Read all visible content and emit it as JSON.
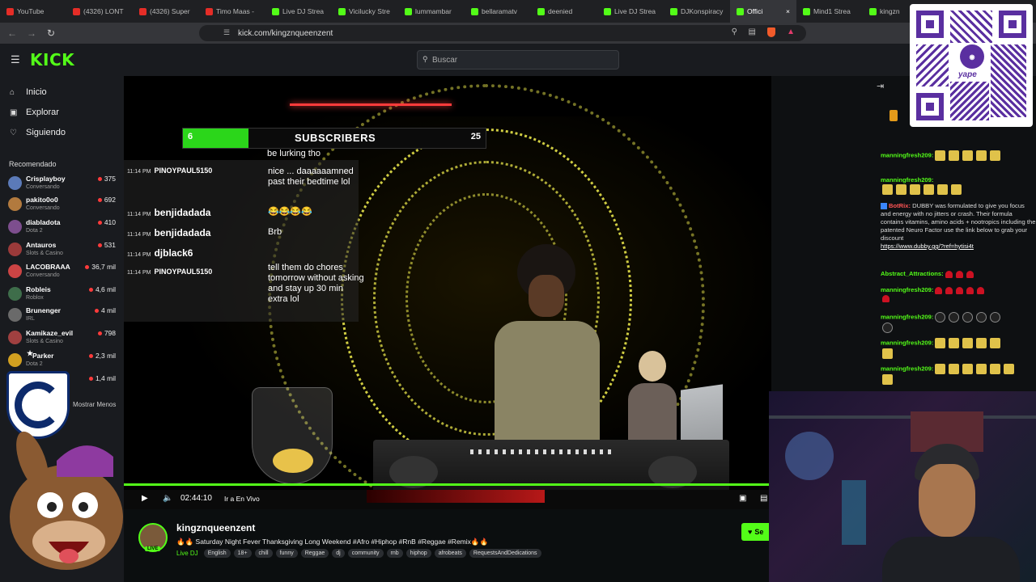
{
  "tabs": [
    {
      "label": "YouTube",
      "icon": "youtube-icon",
      "active": false
    },
    {
      "label": "(4326) LONT",
      "icon": "youtube-icon",
      "active": false
    },
    {
      "label": "(4326) Super",
      "icon": "youtube-icon",
      "active": false
    },
    {
      "label": "Timo Maas -",
      "icon": "youtube-icon",
      "active": false
    },
    {
      "label": "Live DJ Strea",
      "icon": "kick-icon",
      "active": false
    },
    {
      "label": "Vicilucky Stre",
      "icon": "kick-icon",
      "active": false
    },
    {
      "label": "lummambar",
      "icon": "kick-icon",
      "active": false
    },
    {
      "label": "bellaramatv",
      "icon": "kick-icon",
      "active": false
    },
    {
      "label": "deenied",
      "icon": "kick-icon",
      "active": false
    },
    {
      "label": "Live DJ Strea",
      "icon": "kick-icon",
      "active": false
    },
    {
      "label": "DJKonspiracy",
      "icon": "kick-icon",
      "active": false
    },
    {
      "label": "Offici",
      "icon": "kick-icon",
      "active": true
    },
    {
      "label": "Mind1 Strea",
      "icon": "kick-icon",
      "active": false
    },
    {
      "label": "kingzn",
      "icon": "kick-icon",
      "active": false
    }
  ],
  "url": "kick.com/kingznqueenzent",
  "logo": "KICK",
  "search_placeholder": "Buscar",
  "nav": {
    "home": "Inicio",
    "explore": "Explorar",
    "following": "Siguiendo"
  },
  "recommended_title": "Recomendado",
  "channels": [
    {
      "name": "Crisplayboy",
      "category": "Conversando",
      "viewers": "375"
    },
    {
      "name": "pakito0o0",
      "category": "Conversando",
      "viewers": "692"
    },
    {
      "name": "diabladota",
      "category": "Dota 2",
      "viewers": "410"
    },
    {
      "name": "Antauros",
      "category": "Slots & Casino",
      "viewers": "531"
    },
    {
      "name": "LACOBRAAA",
      "category": "Conversando",
      "viewers": "36,7 mil"
    },
    {
      "name": "Robleis",
      "category": "Roblox",
      "viewers": "4,6 mil"
    },
    {
      "name": "Brunenger",
      "category": "IRL",
      "viewers": "4 mil"
    },
    {
      "name": "Kamikaze_evil",
      "category": "Slots & Casino",
      "viewers": "798"
    },
    {
      "name": "Parker",
      "category": "Dota 2",
      "viewers": "2,3 mil"
    },
    {
      "name": "",
      "category": "",
      "viewers": "1,4 mil"
    }
  ],
  "show_more": "Mostrar Menos",
  "video": {
    "sub_goal": {
      "label": "SUBSCRIBERS",
      "current": "6",
      "target": "25",
      "progress": 0.24
    },
    "overlay_chat": [
      {
        "time": "11:14 PM",
        "user": "PINOYPAUL5150",
        "text": "nice ... daaaaaamned past their bedtime lol"
      },
      {
        "time": "11:14 PM",
        "user": "benjidadada",
        "text": "😂😂😂😂"
      },
      {
        "time": "11:14 PM",
        "user": "benjidadada",
        "text": "Brb"
      },
      {
        "time": "11:14 PM",
        "user": "djblack6",
        "text": ""
      },
      {
        "time": "11:14 PM",
        "user": "PINOYPAUL5150",
        "text": "tell them do chores tomorrow without asking and stay up 30 min extra lol"
      }
    ],
    "overlay_top_text": "be lurking tho"
  },
  "controls": {
    "time": "02:44:10",
    "live_label": "Ir a En Vivo",
    "progress": 1.0
  },
  "stream": {
    "channel": "kingznqueenzent",
    "title": "🔥🔥 Saturday Night Fever Thanksgiving Long Weekend #Afro  #Hiphop #RnB #Reggae #Remix🔥🔥",
    "live_badge": "LIVE",
    "category": "Live DJ",
    "tags": [
      "English",
      "18+",
      "chill",
      "funny",
      "Reggae",
      "dj",
      "community",
      "rnb",
      "hiphop",
      "afrobeats",
      "RequestsAndDedications"
    ],
    "follow_label": "Se"
  },
  "chat": [
    {
      "user": "manningfresh209:",
      "text": "",
      "emotes": 5,
      "kind": "gold"
    },
    {
      "user": "manningfresh209:",
      "text": "",
      "emotes": 6,
      "kind": "gold"
    },
    {
      "user": "BotRix:",
      "text": "DUBBY was formulated to give you focus and energy with no jitters or crash. Their formula contains vitamins, amino acids + nootropics including the patented Neuro Factor use the link below to grab your discount",
      "link": "https://www.dubby.gg/?ref=hytisi4t",
      "bot": true
    },
    {
      "user": "Abstract_Attractions:",
      "text": "",
      "emotes": 3,
      "kind": "red"
    },
    {
      "user": "manningfresh209:",
      "text": "",
      "emotes": 7,
      "kind": "red"
    },
    {
      "user": "manningfresh209:",
      "text": "",
      "emotes": 7,
      "kind": "blk"
    },
    {
      "user": "manningfresh209:",
      "text": "",
      "emotes": 6,
      "kind": "gold"
    },
    {
      "user": "manningfresh209:",
      "text": "",
      "emotes": 7,
      "kind": "gold"
    }
  ],
  "qr_brand": "yape",
  "mascot_badge_letter": "C",
  "colors": {
    "kick_green": "#53fc18",
    "bg": "#0b0e0f",
    "sidebar": "#191b1f",
    "live_red": "#ff3b3b",
    "yape_purple": "#5a2fa0"
  }
}
